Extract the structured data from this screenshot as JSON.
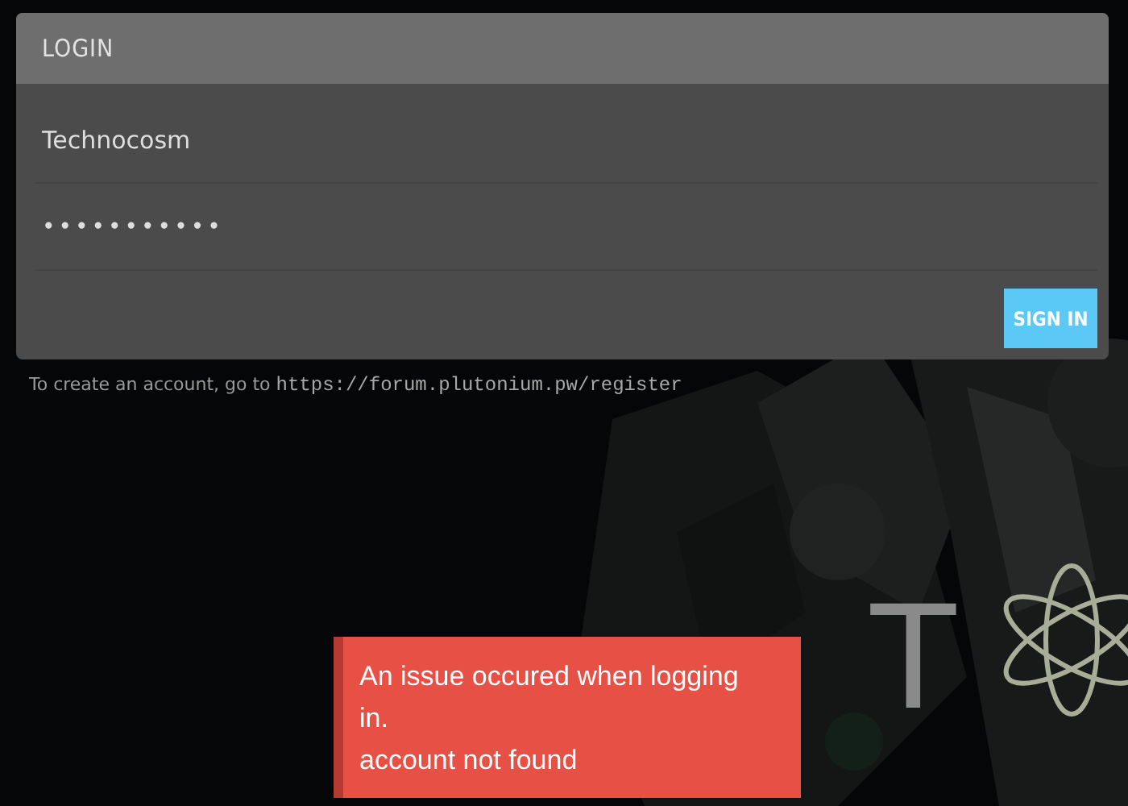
{
  "login": {
    "title": "LOGIN",
    "username": "Technocosm",
    "password": "•••••••••••",
    "button": "SIGN IN"
  },
  "register_note": {
    "text": "To create an account, go to ",
    "url": "https://forum.plutonium.pw/register"
  },
  "background": {
    "kind": "picture",
    "logo_text": "T"
  },
  "toast": {
    "message": "An issue occured when logging in.",
    "detail": "account not found"
  }
}
